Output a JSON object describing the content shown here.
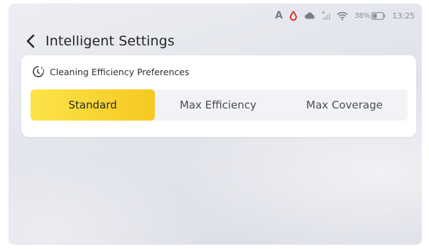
{
  "status_bar": {
    "indicator_a": "A",
    "icons": [
      "drop-icon",
      "cloud-icon",
      "no-signal-icon",
      "wifi-icon"
    ],
    "battery_text": "38%",
    "time": "13:25",
    "accent_red": "#e0352b"
  },
  "header": {
    "back_icon": "chevron-left-icon",
    "title": "Intelligent Settings"
  },
  "card": {
    "icon": "cleaning-efficiency-icon",
    "title": "Cleaning Efficiency Preferences",
    "options": [
      {
        "label": "Standard",
        "selected": true
      },
      {
        "label": "Max Efficiency",
        "selected": false
      },
      {
        "label": "Max Coverage",
        "selected": false
      }
    ],
    "accent_color": "#f8d630"
  }
}
